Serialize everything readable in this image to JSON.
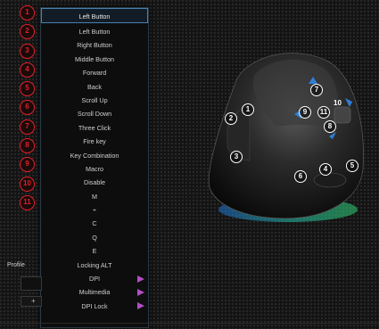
{
  "numbers": [
    "1",
    "2",
    "3",
    "4",
    "5",
    "6",
    "7",
    "8",
    "9",
    "10",
    "11"
  ],
  "menu": {
    "selected": "Left Button",
    "items": [
      {
        "label": "Left Button",
        "submenu": false
      },
      {
        "label": "Right Button",
        "submenu": false
      },
      {
        "label": "Middle Button",
        "submenu": false
      },
      {
        "label": "Forward",
        "submenu": false
      },
      {
        "label": "Back",
        "submenu": false
      },
      {
        "label": "Scroll Up",
        "submenu": false
      },
      {
        "label": "Scroll Down",
        "submenu": false
      },
      {
        "label": "Three Click",
        "submenu": false
      },
      {
        "label": "Fire key",
        "submenu": false
      },
      {
        "label": "Key Combination",
        "submenu": false
      },
      {
        "label": "Macro",
        "submenu": false
      },
      {
        "label": "Disable",
        "submenu": false
      },
      {
        "label": "M",
        "submenu": false
      },
      {
        "label": "÷",
        "submenu": false
      },
      {
        "label": "C",
        "submenu": false
      },
      {
        "label": "Q",
        "submenu": false
      },
      {
        "label": "E",
        "submenu": false
      },
      {
        "label": "Locking ALT",
        "submenu": false
      },
      {
        "label": "DPI",
        "submenu": true
      },
      {
        "label": "Multimedia",
        "submenu": true
      },
      {
        "label": "DPI Lock",
        "submenu": true
      }
    ]
  },
  "profile": {
    "label": "Profile",
    "add_label": "+"
  },
  "mouse_callouts": [
    "1",
    "2",
    "3",
    "4",
    "5",
    "6",
    "7",
    "8",
    "9",
    "10",
    "11"
  ],
  "colors": {
    "accent_red": "#e0202a",
    "submenu_arrow": "#b24fc4",
    "selected_border": "#4a80b0",
    "marker_blue": "#2f7fd6"
  }
}
